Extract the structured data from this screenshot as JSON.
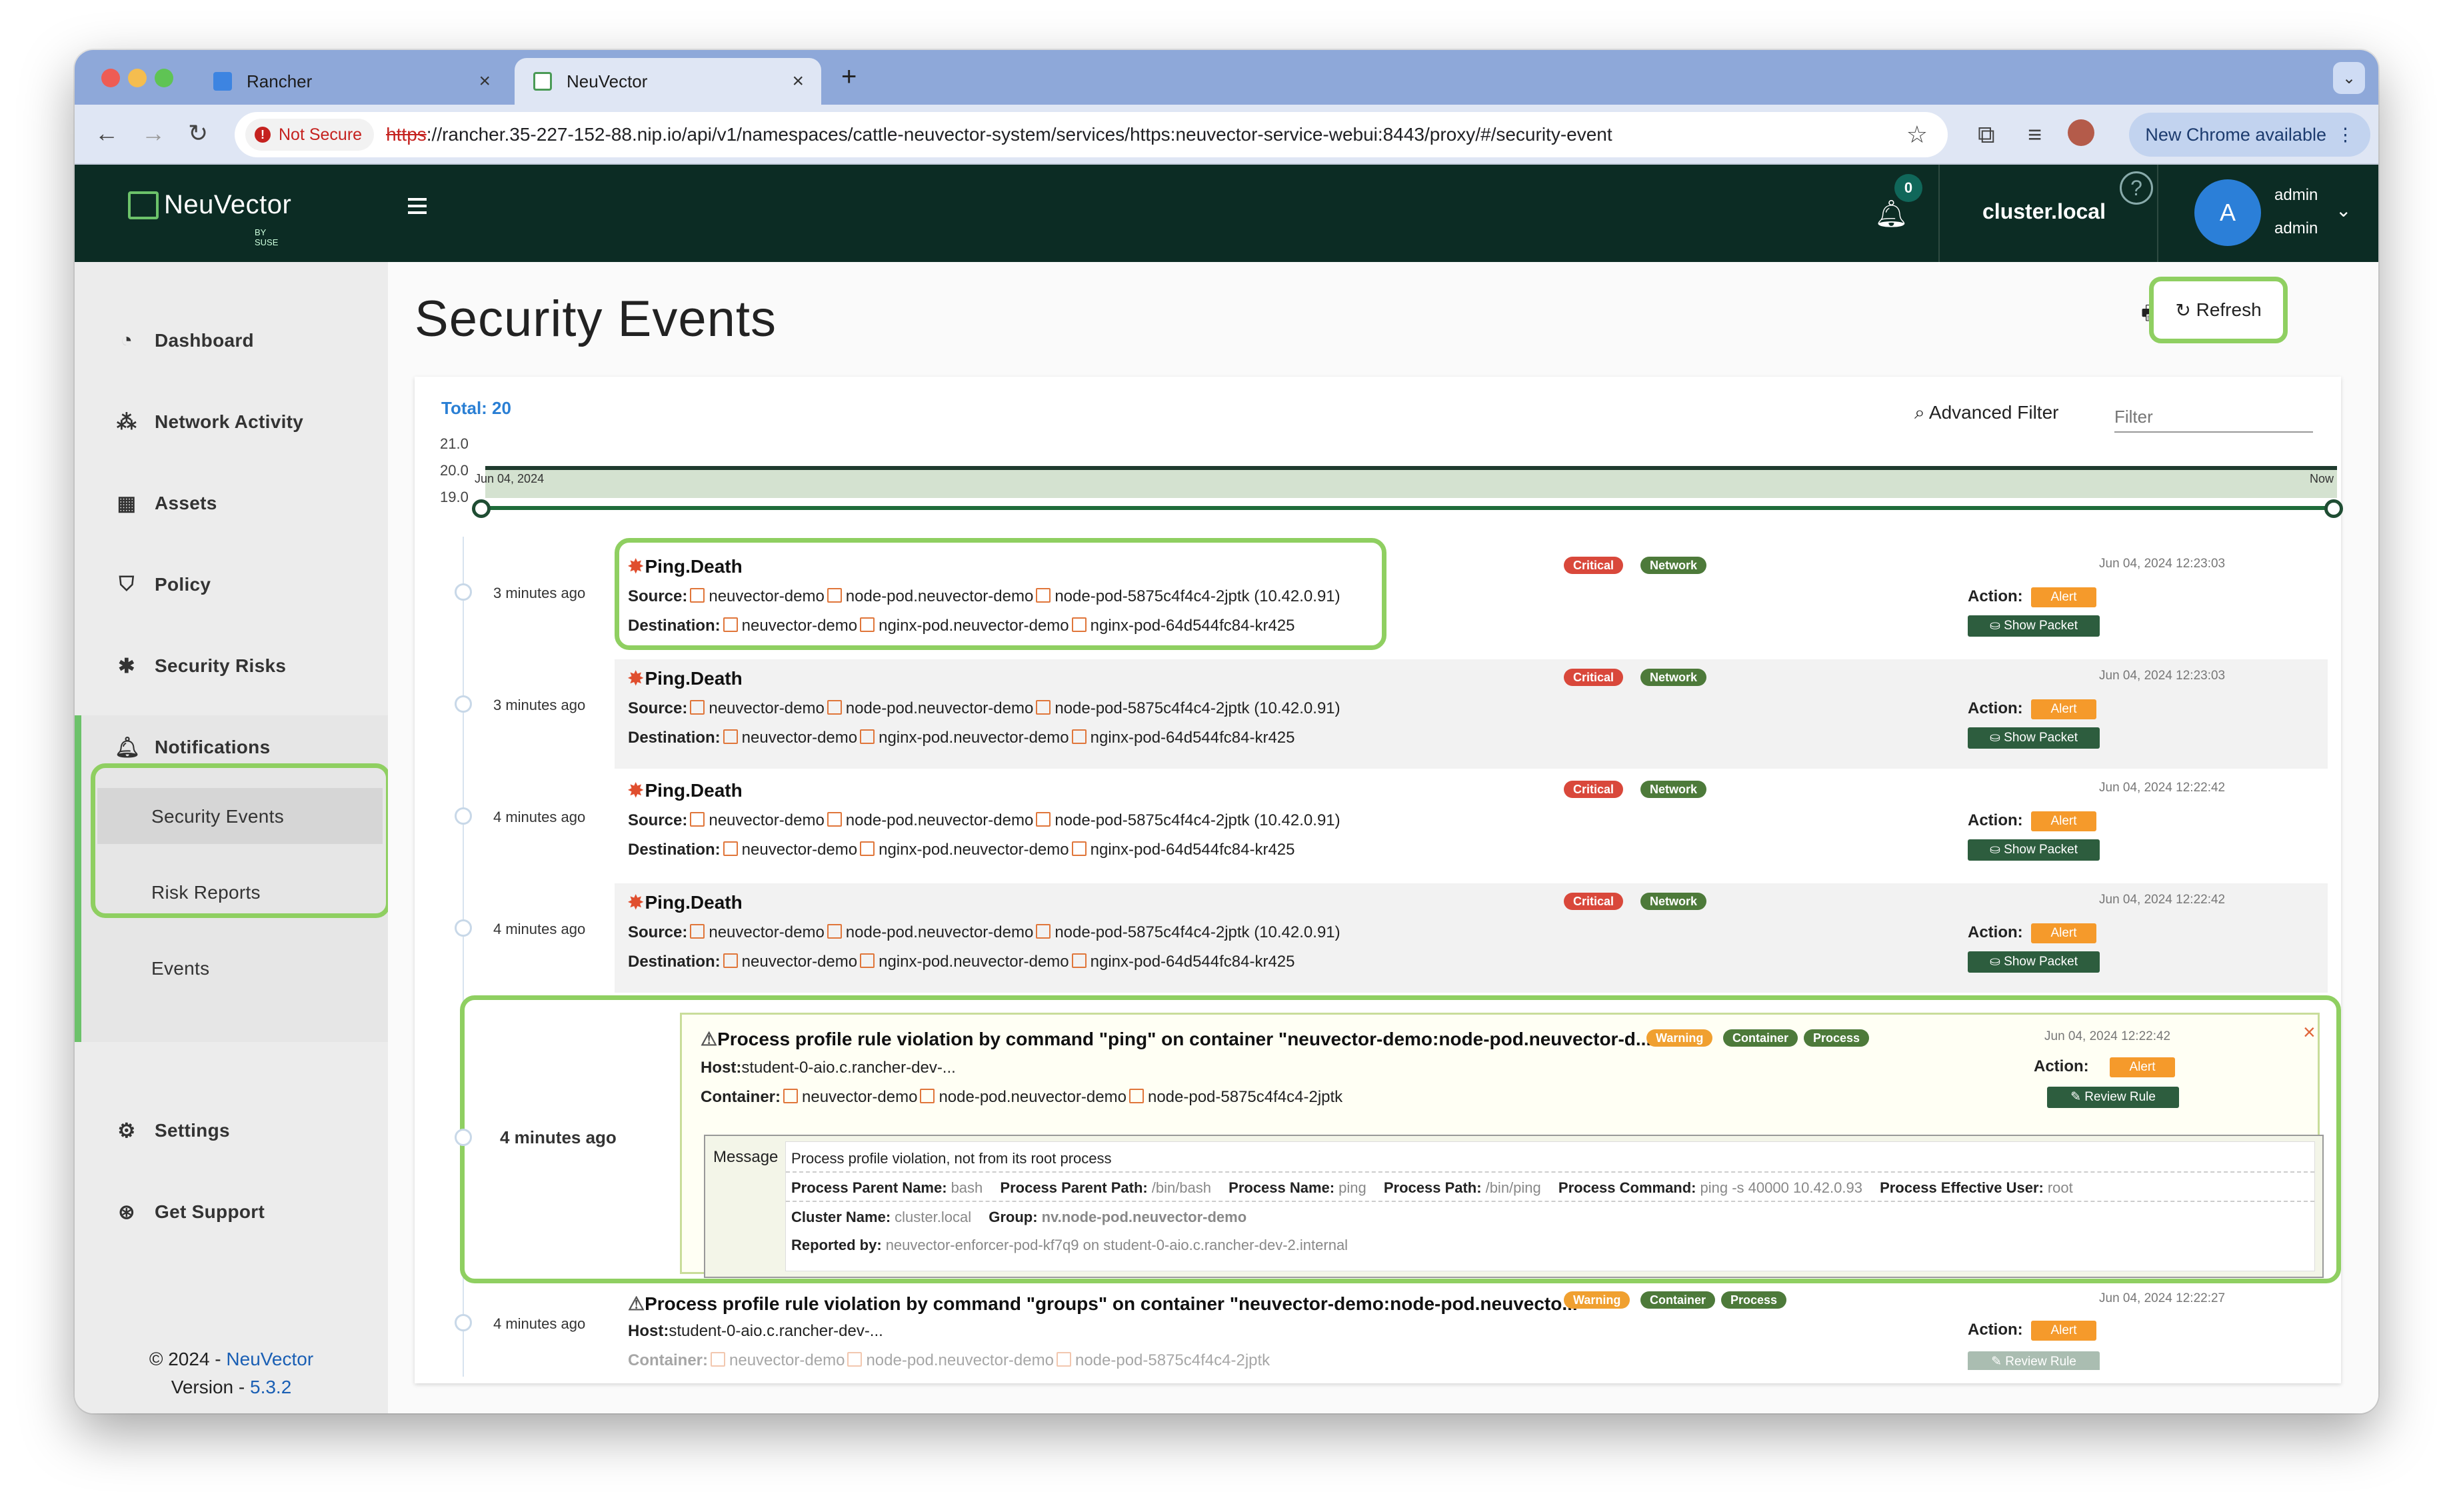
{
  "browser": {
    "tabs": [
      {
        "label": "Rancher"
      },
      {
        "label": "NeuVector"
      }
    ],
    "not_secure": "Not Secure",
    "url_scheme": "https",
    "url_rest": "://rancher.35-227-152-88.nip.io/api/v1/namespaces/cattle-neuvector-system/services/https:neuvector-service-webui:8443/proxy/#/security-event",
    "new_chrome": "New Chrome available"
  },
  "header": {
    "brand": "NeuVector",
    "brand_sub": "BY SUSE",
    "notif_count": "0",
    "cluster": "cluster.local",
    "avatar": "A",
    "user_name": "admin",
    "user_role": "admin"
  },
  "sidebar": {
    "items": [
      {
        "label": "Dashboard"
      },
      {
        "label": "Network Activity"
      },
      {
        "label": "Assets"
      },
      {
        "label": "Policy"
      },
      {
        "label": "Security Risks"
      },
      {
        "label": "Notifications"
      },
      {
        "label": "Settings"
      },
      {
        "label": "Get Support"
      }
    ],
    "sub_items": [
      {
        "label": "Security Events"
      },
      {
        "label": "Risk Reports"
      },
      {
        "label": "Events"
      }
    ],
    "copyright": "© 2024 - ",
    "copyright_link": "NeuVector",
    "version_label": "Version - ",
    "version": "5.3.2"
  },
  "main": {
    "title": "Security Events",
    "refresh_label": "Refresh",
    "total": "Total: 20",
    "advanced_filter": "Advanced Filter",
    "filter_placeholder": "Filter",
    "axis": {
      "top": "21.0",
      "mid": "20.0",
      "bottom": "19.0"
    },
    "timeline_start": "Jun 04, 2024",
    "timeline_end": "Now"
  },
  "labels": {
    "source": "Source:",
    "destination": "Destination:",
    "action": "Action:",
    "alert": "Alert",
    "show_packet": "Show Packet",
    "review_rule": "Review Rule",
    "host": "Host:",
    "container": "Container:",
    "message": "Message",
    "critical": "Critical",
    "network": "Network",
    "warning": "Warning",
    "container_tag": "Container",
    "process_tag": "Process"
  },
  "events": [
    {
      "time": "3 minutes ago",
      "title": "Ping.Death",
      "date": "Jun 04, 2024 12:23:03",
      "src_ns": "neuvector-demo",
      "src_svc": "node-pod.neuvector-demo",
      "src_pod": "node-pod-5875c4f4c4-2jptk (10.42.0.91)",
      "dst_ns": "neuvector-demo",
      "dst_svc": "nginx-pod.neuvector-demo",
      "dst_pod": "nginx-pod-64d544fc84-kr425"
    },
    {
      "time": "3 minutes ago",
      "title": "Ping.Death",
      "date": "Jun 04, 2024 12:23:03",
      "src_ns": "neuvector-demo",
      "src_svc": "node-pod.neuvector-demo",
      "src_pod": "node-pod-5875c4f4c4-2jptk (10.42.0.91)",
      "dst_ns": "neuvector-demo",
      "dst_svc": "nginx-pod.neuvector-demo",
      "dst_pod": "nginx-pod-64d544fc84-kr425"
    },
    {
      "time": "4 minutes ago",
      "title": "Ping.Death",
      "date": "Jun 04, 2024 12:22:42",
      "src_ns": "neuvector-demo",
      "src_svc": "node-pod.neuvector-demo",
      "src_pod": "node-pod-5875c4f4c4-2jptk (10.42.0.91)",
      "dst_ns": "neuvector-demo",
      "dst_svc": "nginx-pod.neuvector-demo",
      "dst_pod": "nginx-pod-64d544fc84-kr425"
    },
    {
      "time": "4 minutes ago",
      "title": "Ping.Death",
      "date": "Jun 04, 2024 12:22:42",
      "src_ns": "neuvector-demo",
      "src_svc": "node-pod.neuvector-demo",
      "src_pod": "node-pod-5875c4f4c4-2jptk (10.42.0.91)",
      "dst_ns": "neuvector-demo",
      "dst_svc": "nginx-pod.neuvector-demo",
      "dst_pod": "nginx-pod-64d544fc84-kr425"
    }
  ],
  "expanded": {
    "time": "4 minutes ago",
    "title": "Process profile rule violation by command \"ping\" on container \"neuvector-demo:node-pod.neuvector-d...",
    "date": "Jun 04, 2024 12:22:42",
    "host": "student-0-aio.c.rancher-dev-...",
    "cont_ns": "neuvector-demo",
    "cont_svc": "node-pod.neuvector-demo",
    "cont_pod": "node-pod-5875c4f4c4-2jptk",
    "message": "Process profile violation, not from its root process",
    "parent_name_l": "Process Parent Name:",
    "parent_name": "bash",
    "parent_path_l": "Process Parent Path:",
    "parent_path": "/bin/bash",
    "proc_name_l": "Process Name:",
    "proc_name": "ping",
    "proc_path_l": "Process Path:",
    "proc_path": "/bin/ping",
    "proc_cmd_l": "Process Command:",
    "proc_cmd": "ping -s 40000 10.42.0.93",
    "proc_user_l": "Process Effective User:",
    "proc_user": "root",
    "cluster_l": "Cluster Name:",
    "cluster": "cluster.local",
    "group_l": "Group:",
    "group": "nv.node-pod.neuvector-demo",
    "reported_l": "Reported by:",
    "reported": "neuvector-enforcer-pod-kf7q9 on student-0-aio.c.rancher-dev-2.internal"
  },
  "last": {
    "time": "4 minutes ago",
    "title": "Process profile rule violation by command \"groups\" on container \"neuvector-demo:node-pod.neuvecto...",
    "date": "Jun 04, 2024 12:22:27",
    "host": "student-0-aio.c.rancher-dev-...",
    "cont_ns": "neuvector-demo",
    "cont_svc": "node-pod.neuvector-demo",
    "cont_pod": "node-pod-5875c4f4c4-2jptk"
  },
  "colors": {
    "accent_green": "#8fcf61",
    "header_bg": "#0c2c24",
    "link_blue": "#2a7fd4",
    "critical": "#d9483b",
    "warning": "#f0a030",
    "alert": "#f59a2b"
  }
}
